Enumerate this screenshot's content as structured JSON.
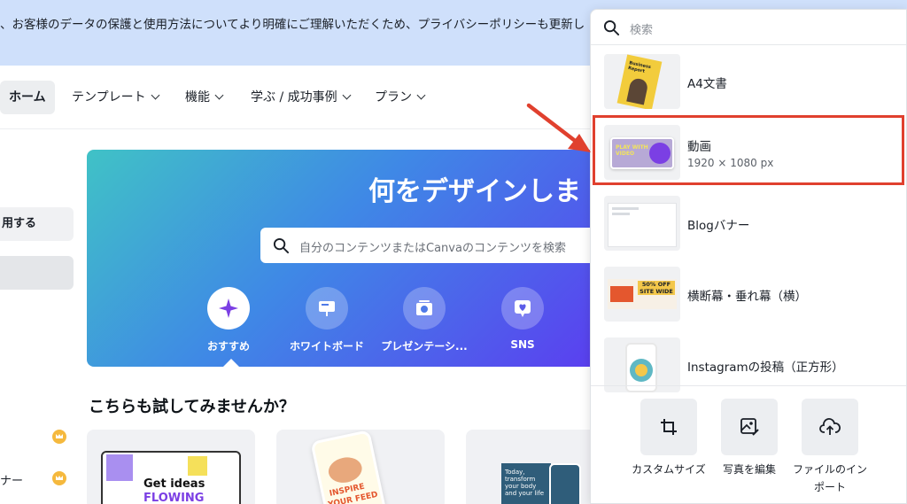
{
  "banner": {
    "text": "、お客様のデータの保護と使用方法についてより明確にご理解いただくため、プライバシーポリシーも更新し"
  },
  "nav": {
    "items": [
      {
        "label": "ホーム"
      },
      {
        "label": "テンプレート"
      },
      {
        "label": "機能"
      },
      {
        "label": "学ぶ / 成功事例"
      },
      {
        "label": "プラン"
      }
    ]
  },
  "sidebar": {
    "items": [
      {
        "label": "用する"
      },
      {
        "label": ""
      },
      {
        "label": "ナー"
      }
    ]
  },
  "hero": {
    "title": "何をデザインしま",
    "search_placeholder": "自分のコンテンツまたはCanvaのコンテンツを検索",
    "categories": [
      {
        "label": "おすすめ",
        "icon": "sparkle-icon"
      },
      {
        "label": "ホワイトボード",
        "icon": "whiteboard-icon"
      },
      {
        "label": "プレゼンテーシ...",
        "icon": "presentation-icon"
      },
      {
        "label": "SNS",
        "icon": "heart-icon"
      }
    ]
  },
  "section": {
    "title": "こちらも試してみませんか？",
    "card1_text_1": "Get ideas",
    "card1_text_2": "FLOWING",
    "card2_text_1": "INSPIRE",
    "card2_text_2": "YOUR FEED",
    "card3_text": "Today, transform your body and your life"
  },
  "panel": {
    "search_placeholder": "検索",
    "items": [
      {
        "title": "A4文書",
        "subtitle": "",
        "thumb_text": "Business Report"
      },
      {
        "title": "動画",
        "subtitle": "1920 × 1080 px",
        "thumb_text": "PLAY WITH VIDEO"
      },
      {
        "title": "Blogバナー",
        "subtitle": "",
        "thumb_text": ""
      },
      {
        "title": "横断幕・垂れ幕（横）",
        "subtitle": "",
        "thumb_text": "50% OFF SITE WIDE"
      },
      {
        "title": "Instagramの投稿（正方形）",
        "subtitle": "",
        "thumb_text": ""
      }
    ],
    "actions": [
      {
        "label": "カスタムサイズ",
        "icon": "crop-icon"
      },
      {
        "label": "写真を編集",
        "icon": "image-edit-icon"
      },
      {
        "label": "ファイルのインポート",
        "icon": "cloud-upload-icon"
      }
    ]
  },
  "colors": {
    "banner": "#cfe0fb",
    "highlight": "#e0402e",
    "arrow": "#e0402e",
    "hero_gradient_start": "#40c2c6",
    "hero_gradient_end": "#5b3ef0"
  }
}
